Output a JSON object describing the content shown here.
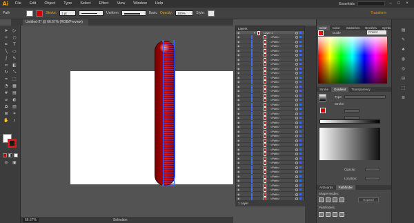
{
  "app": {
    "logo": "Ai"
  },
  "menu": [
    "File",
    "Edit",
    "Object",
    "Type",
    "Select",
    "Effect",
    "View",
    "Window",
    "Help"
  ],
  "workspace": {
    "label": "Essentials",
    "search_placeholder": ""
  },
  "control": {
    "selection_label": "Path",
    "stroke_label": "Stroke:",
    "stroke_weight": "1 pt",
    "profile": "Uniform",
    "brush": "Basic",
    "opacity_label": "Opacity:",
    "opacity": "100%",
    "style_label": "Style:",
    "transform_label": "Transform"
  },
  "document": {
    "tab_title": "Untitled-2* @ 66.67% (RGB/Preview)"
  },
  "status": {
    "zoom": "66.67%",
    "tool": "Selection"
  },
  "layers": {
    "tab_label": "Layers",
    "layer_name": "Layer 1",
    "path_label": "<Path>",
    "path_rows": 37,
    "footer_label": "1 Layer"
  },
  "color_panel": {
    "tabs": [
      "Color",
      "Color Guide",
      "Swatches",
      "Brushes",
      "Symbols"
    ],
    "hex": "FF0007"
  },
  "gradient_panel": {
    "tabs": [
      "Stroke",
      "Gradient",
      "Transparency"
    ],
    "type_label": "Type:",
    "stroke_label": "Stroke:",
    "opacity_label": "Opacity:",
    "location_label": "Location:"
  },
  "bottom_panel": {
    "tabs": [
      "Artboards",
      "Pathfinder"
    ],
    "shape_modes": "Shape Modes:",
    "pathfinders": "Pathfinders:",
    "expand": "Expand"
  },
  "colors": {
    "fill": "#ffffff",
    "stroke": "#cc0000",
    "accent": "#ff9a00"
  }
}
